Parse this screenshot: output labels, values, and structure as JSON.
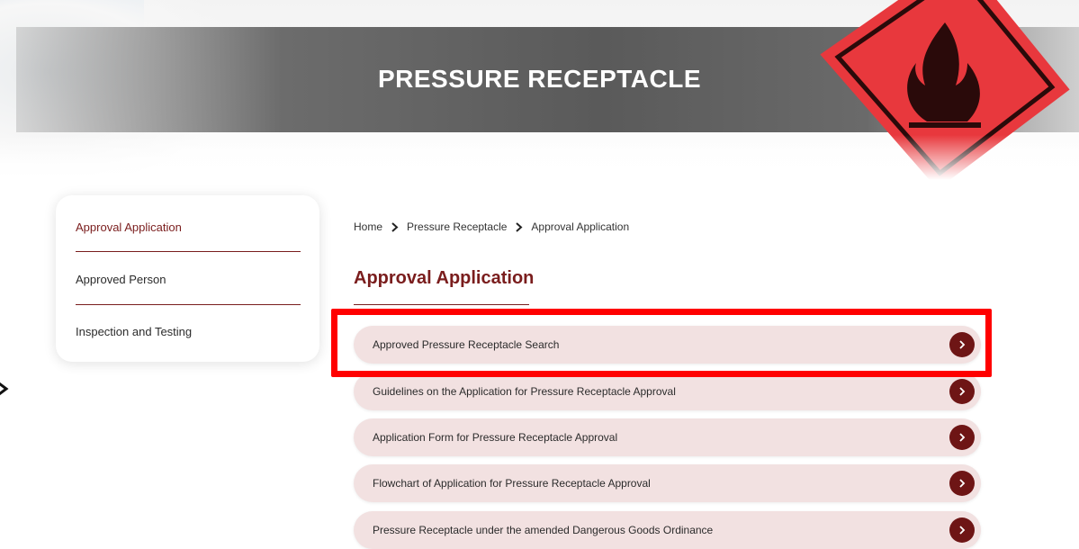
{
  "hero": {
    "title": "PRESSURE RECEPTACLE"
  },
  "sidebar": {
    "items": [
      {
        "label": "Approval Application",
        "active": true
      },
      {
        "label": "Approved Person",
        "active": false
      },
      {
        "label": "Inspection and Testing",
        "active": false
      }
    ]
  },
  "breadcrumb": {
    "items": [
      "Home",
      "Pressure Receptacle",
      "Approval Application"
    ],
    "separator_icon": "chevron-right-icon"
  },
  "main": {
    "title": "Approval Application",
    "links": [
      {
        "label": "Approved Pressure Receptacle Search",
        "highlighted": true
      },
      {
        "label": "Guidelines on the Application for Pressure Receptacle Approval",
        "highlighted": false
      },
      {
        "label": "Application Form for Pressure Receptacle Approval",
        "highlighted": false
      },
      {
        "label": "Flowchart of Application for Pressure Receptacle Approval",
        "highlighted": false
      },
      {
        "label": "Pressure Receptacle under the amended Dangerous Goods Ordinance",
        "highlighted": false
      }
    ],
    "link_icon": "arrow-circle-right-icon"
  },
  "colors": {
    "accent": "#7a1d1d",
    "button": "#6e1515",
    "row_bg": "#f2e1e1",
    "highlight": "#ff0000",
    "hazard_red": "#e8383d"
  }
}
